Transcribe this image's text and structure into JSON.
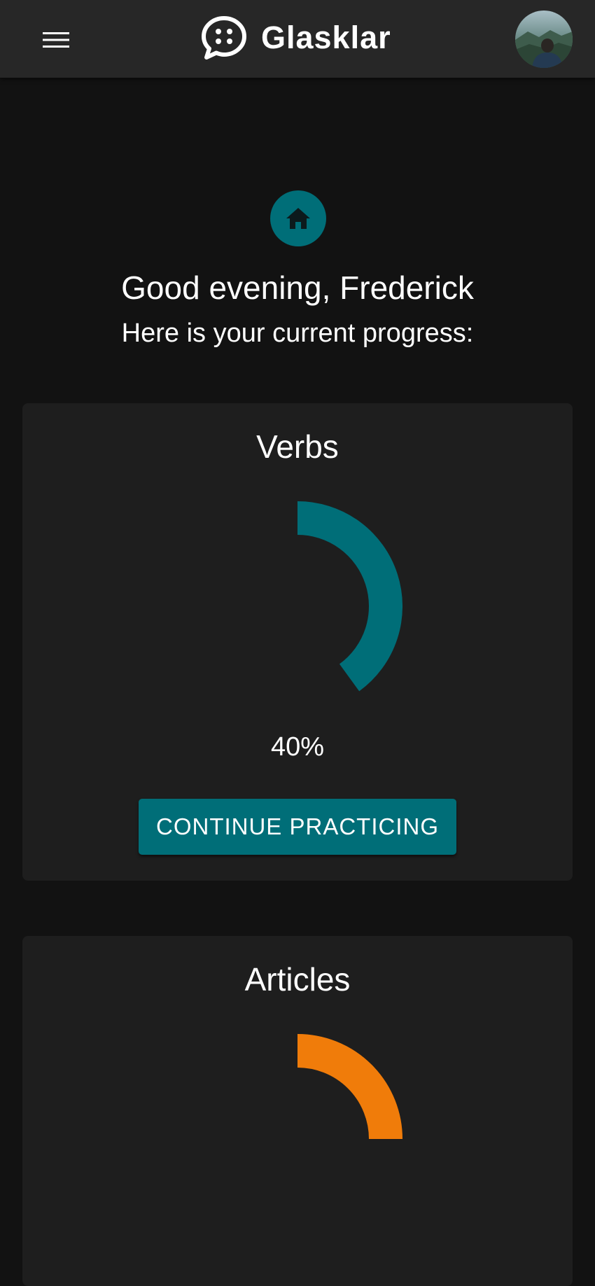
{
  "header": {
    "app_name": "Glasklar",
    "menu_icon": "hamburger-menu-icon",
    "logo_icon": "chat-bubble-logo-icon",
    "avatar": "user-avatar"
  },
  "hero": {
    "icon": "home-icon",
    "greeting": "Good evening, Frederick",
    "subtitle": "Here is your current progress:"
  },
  "progress_cards": [
    {
      "title": "Verbs",
      "progress": 0.4,
      "percent_label": "40%",
      "color": "#006e78",
      "button_label": "CONTINUE PRACTICING"
    },
    {
      "title": "Articles",
      "progress": 0.25,
      "color": "#f07c0a"
    }
  ],
  "colors": {
    "background": "#121212",
    "app_bar": "#272727",
    "card": "#1e1e1e",
    "accent": "#006e78"
  }
}
